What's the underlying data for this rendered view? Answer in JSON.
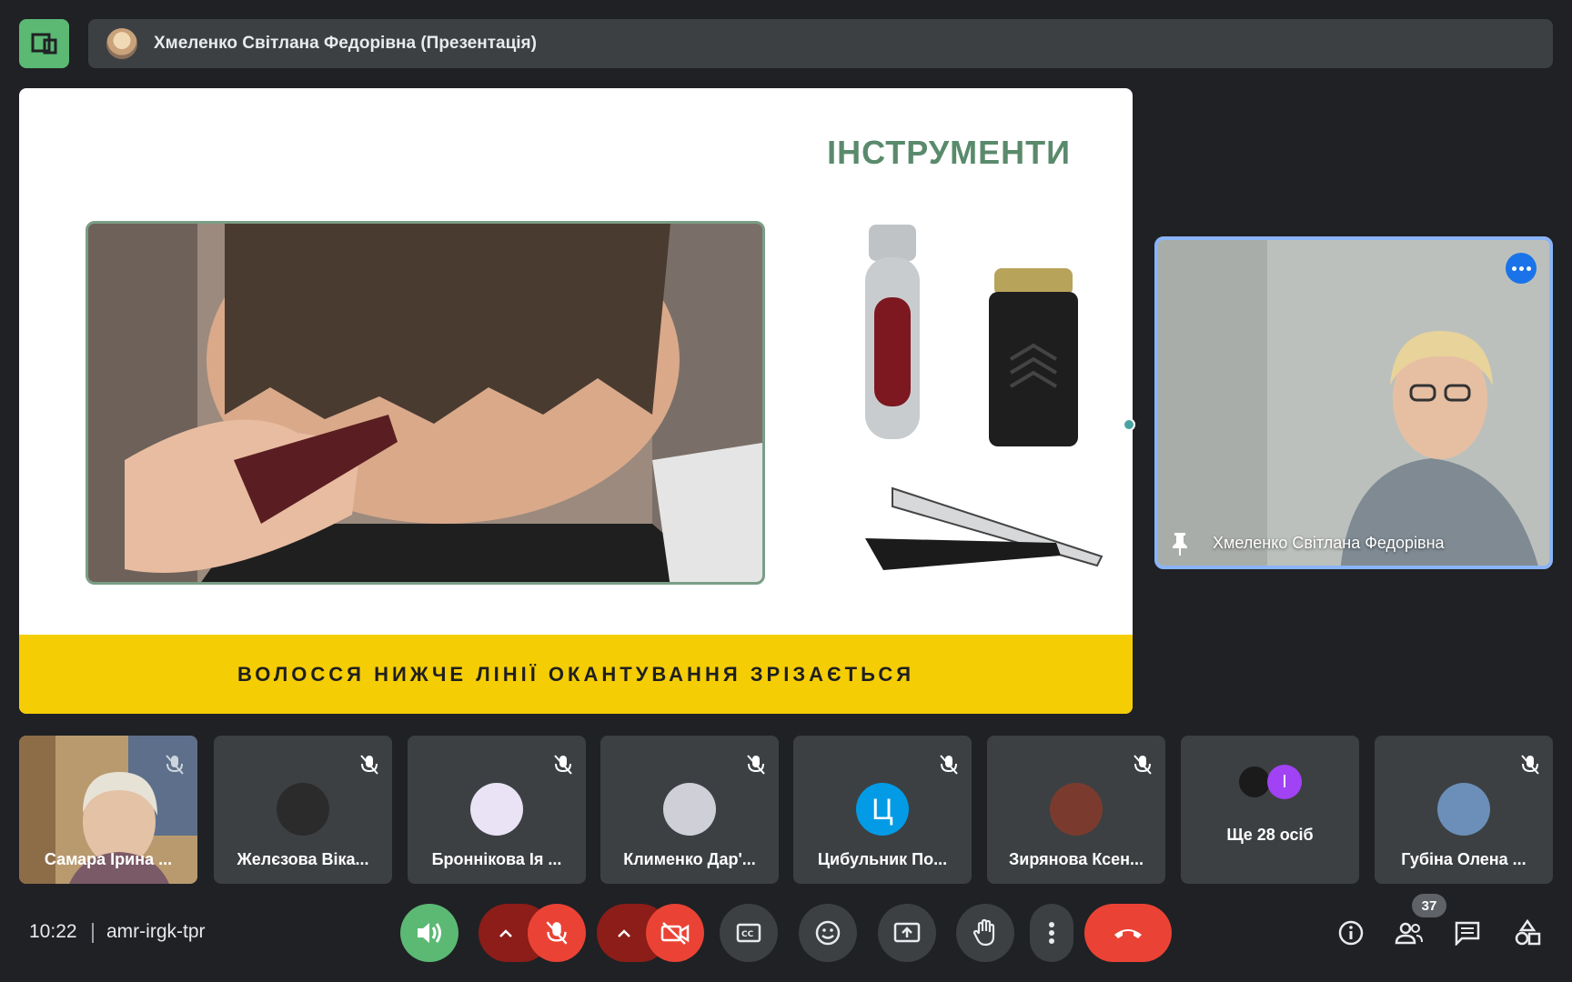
{
  "header": {
    "title": "Хмеленко Світлана Федорівна (Презентація)",
    "layout_icon": "layout-icon",
    "avatar_icon": "avatar"
  },
  "slide": {
    "heading": "ІНСТРУМЕНТИ",
    "caption": "ВОЛОССЯ НИЖЧЕ ЛІНІЇ ОКАНТУВАННЯ ЗРІЗАЄТЬСЯ",
    "banner_color": "#f5cd05",
    "heading_color": "#5a8a6c"
  },
  "presenter": {
    "name": "Хмеленко Світлана Федорівна",
    "border_color": "#8ab4f8"
  },
  "participants": [
    {
      "name": "Самара Ірина ...",
      "type": "video"
    },
    {
      "name": "Желєзова Віка...",
      "type": "avatar",
      "color": "#2b2b2b",
      "muted": true
    },
    {
      "name": "Броннікова Ія ...",
      "type": "avatar",
      "color": "#e9e3f5",
      "muted": true
    },
    {
      "name": "Клименко Дар'...",
      "type": "avatar",
      "color": "#cfcfd8",
      "muted": true
    },
    {
      "name": "Цибульник По...",
      "type": "initial",
      "initial": "Ц",
      "color": "#039be5",
      "muted": true
    },
    {
      "name": "Зирянова Ксен...",
      "type": "avatar",
      "color": "#7a3b2e",
      "muted": true
    },
    {
      "name": "Ще 28 осіб",
      "type": "more",
      "initial": "І",
      "color": "#a142f4"
    },
    {
      "name": "Губіна Олена ...",
      "type": "avatar",
      "color": "#6b8fb8",
      "muted": true
    }
  ],
  "footer": {
    "time": "10:22",
    "meeting_code": "amr-irgk-tpr",
    "participant_count": "37",
    "colors": {
      "leave": "#ea4335",
      "audio": "#5bb974",
      "bar": "#202124"
    }
  }
}
